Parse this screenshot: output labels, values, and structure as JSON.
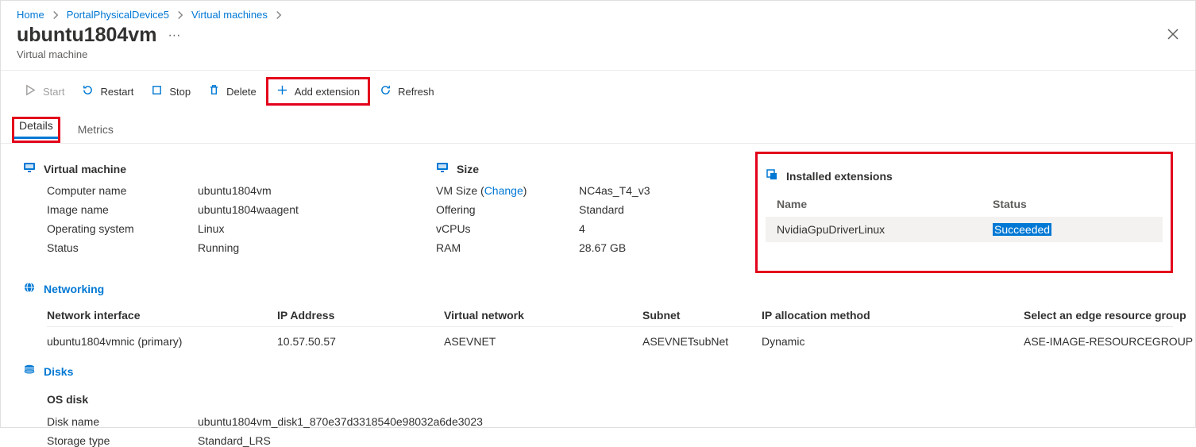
{
  "breadcrumb": {
    "home": "Home",
    "device": "PortalPhysicalDevice5",
    "vms": "Virtual machines"
  },
  "title": "ubuntu1804vm",
  "subtitle": "Virtual machine",
  "toolbar": {
    "start": "Start",
    "restart": "Restart",
    "stop": "Stop",
    "delete": "Delete",
    "add_ext": "Add extension",
    "refresh": "Refresh"
  },
  "tabs": {
    "details": "Details",
    "metrics": "Metrics"
  },
  "vm": {
    "section": "Virtual machine",
    "computer_name_k": "Computer name",
    "computer_name_v": "ubuntu1804vm",
    "image_name_k": "Image name",
    "image_name_v": "ubuntu1804waagent",
    "os_k": "Operating system",
    "os_v": "Linux",
    "status_k": "Status",
    "status_v": "Running"
  },
  "size": {
    "section": "Size",
    "vm_size_k": "VM Size (",
    "vm_size_link": "Change",
    "vm_size_k2": ")",
    "vm_size_v": "NC4as_T4_v3",
    "offering_k": "Offering",
    "offering_v": "Standard",
    "vcpus_k": "vCPUs",
    "vcpus_v": "4",
    "ram_k": "RAM",
    "ram_v": "28.67 GB"
  },
  "ext": {
    "section": "Installed extensions",
    "name_h": "Name",
    "status_h": "Status",
    "row_name": "NvidiaGpuDriverLinux",
    "row_status": "Succeeded"
  },
  "net": {
    "section": "Networking",
    "h_nic": "Network interface",
    "h_ip": "IP Address",
    "h_vnet": "Virtual network",
    "h_subnet": "Subnet",
    "h_alloc": "IP allocation method",
    "h_rg": "Select an edge resource group",
    "r_nic": "ubuntu1804vmnic (primary)",
    "r_ip": "10.57.50.57",
    "r_vnet": "ASEVNET",
    "r_subnet": "ASEVNETsubNet",
    "r_alloc": "Dynamic",
    "r_rg": "ASE-IMAGE-RESOURCEGROUP"
  },
  "disks": {
    "section": "Disks",
    "os_disk": "OS disk",
    "name_k": "Disk name",
    "name_v": "ubuntu1804vm_disk1_870e37d3318540e98032a6de3023",
    "type_k": "Storage type",
    "type_v": "Standard_LRS"
  }
}
